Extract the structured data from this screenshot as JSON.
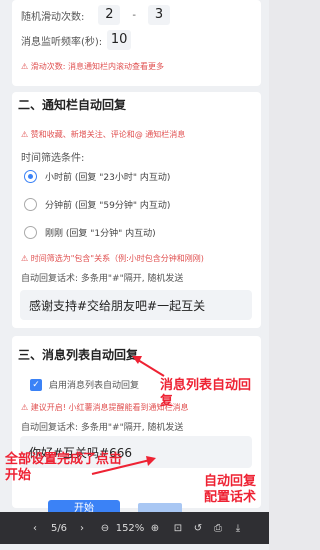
{
  "settings": {
    "random_slide_label": "随机滑动次数:",
    "random_slide_min": "2",
    "random_slide_dash": "-",
    "random_slide_max": "3",
    "notify_freq_label": "消息监听频率(秒):",
    "notify_freq_value": "10",
    "slide_warning": "⚠ 滑动次数: 消息通知栏内滚动查看更多"
  },
  "section2": {
    "title": "二、通知栏自动回复",
    "warning": "⚠ 赞和收藏、新增关注、评论和@ 通知栏消息",
    "filter_label": "时间筛选条件:",
    "options": [
      {
        "label": "小时前 (回复 \"23小时\" 内互动)",
        "selected": true
      },
      {
        "label": "分钟前 (回复 \"59分钟\" 内互动)",
        "selected": false
      },
      {
        "label": "刚刚 (回复 \"1分钟\" 内互动)",
        "selected": false
      }
    ],
    "time_note": "⚠ 时间筛选为\"包含\"关系（例:小时包含分钟和刚刚)",
    "reply_label": "自动回复话术: 多条用\"#\"隔开, 随机发送",
    "reply_value": "感谢支持#交给朋友吧#一起互关"
  },
  "section3": {
    "title": "三、消息列表自动回复",
    "checkbox_label": "启用消息列表自动回复",
    "warning": "⚠ 建议开启! 小红薯消息提醒能看到通知栏消息",
    "reply_label": "自动回复话术: 多条用\"#\"隔开, 随机发送",
    "reply_value": "你好#互关吗#666"
  },
  "annotations": {
    "msg_list": "消息列表自动回复",
    "all_done": "全部设置完成了点击开始",
    "auto_reply": "自动回复配置话术"
  },
  "start_button": "开始",
  "viewer": {
    "page": "5/6",
    "zoom": "152%"
  },
  "colors": {
    "accent": "#3b82f6",
    "warning": "#e05050",
    "annotation": "#e22233"
  }
}
